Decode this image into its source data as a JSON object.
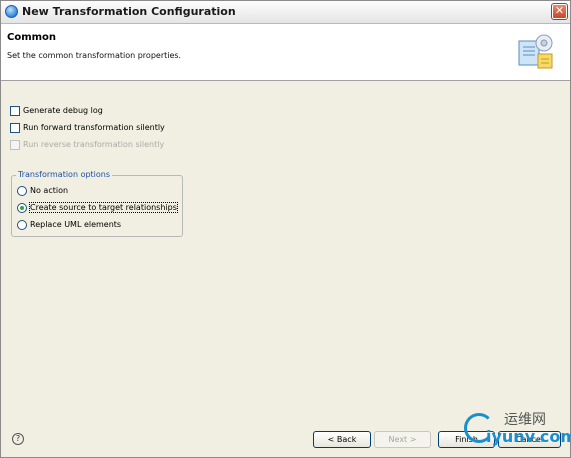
{
  "window": {
    "title": "New Transformation Configuration",
    "close_glyph": "✕"
  },
  "header": {
    "title": "Common",
    "description": "Set the common transformation properties."
  },
  "options": {
    "generate_debug_log": {
      "label": "Generate debug log",
      "checked": false,
      "enabled": true
    },
    "run_forward_silently": {
      "label": "Run forward transformation silently",
      "checked": false,
      "enabled": true
    },
    "run_reverse_silently": {
      "label": "Run reverse transformation silently",
      "checked": false,
      "enabled": false
    }
  },
  "transformation_options": {
    "legend": "Transformation options",
    "choices": [
      {
        "label": "No action",
        "selected": false
      },
      {
        "label": "Create source to target relationships",
        "selected": true
      },
      {
        "label": "Replace UML elements",
        "selected": false
      }
    ]
  },
  "footer": {
    "help_glyph": "?",
    "back_label": "< Back",
    "next_label": "Next >",
    "finish_label": "Finish",
    "cancel_label": "Cancel"
  },
  "watermark": {
    "top": "运维网",
    "bottom": "iyunv.com"
  },
  "colors": {
    "legend_text": "#1e4fa8",
    "radio_dot": "#3aa23a",
    "header_bg": "#ffffff",
    "dialog_bg": "#f1efe2"
  },
  "icons": [
    "info-circle-icon",
    "close-icon",
    "wizard-settings-icon",
    "help-icon"
  ]
}
